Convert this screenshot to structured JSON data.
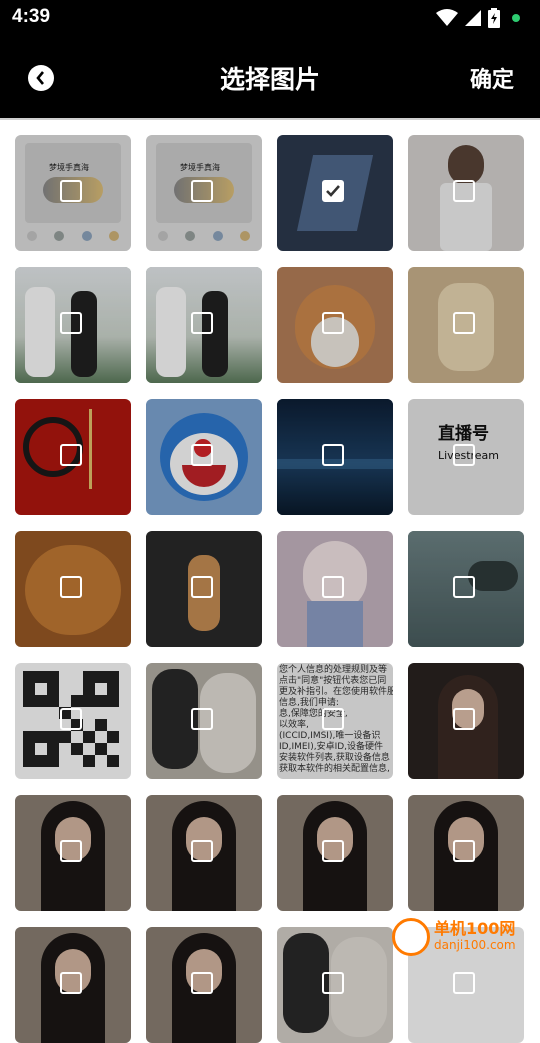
{
  "status": {
    "time": "4:39"
  },
  "header": {
    "title": "选择图片",
    "confirm_label": "确定"
  },
  "thumb_notes": {
    "card_title": "梦境手真海",
    "livestream_title": "直播号",
    "livestream_sub": "Livestream",
    "doc_lines": [
      "您个人信息的处理规则及等",
      "点击\"同意\"按钮代表您已同",
      "更及补指引。在您使用软件服",
      "信息,我们申请:",
      "息,保障您的安全,",
      "以效率,",
      "(ICCID,IMSI),唯一设备识",
      "ID,IMEI),安卓ID,设备硬件",
      "安装软件列表,获取设备信息",
      "获取本软件的相关配置信息,"
    ]
  },
  "thumbs": [
    {
      "name": "palette-card",
      "checked": false,
      "bg": "#e2e2e2"
    },
    {
      "name": "palette-card-2",
      "checked": false,
      "bg": "#e2e2e2"
    },
    {
      "name": "mecha-robot",
      "checked": true,
      "bg": "#2d3a4f"
    },
    {
      "name": "girl-white-dress",
      "checked": false,
      "bg": "#d9d6d4"
    },
    {
      "name": "street-people-1",
      "checked": false,
      "bg": "#6f8a73"
    },
    {
      "name": "street-people-2",
      "checked": false,
      "bg": "#6f8a73"
    },
    {
      "name": "corgi-dog",
      "checked": false,
      "bg": "#b7805a"
    },
    {
      "name": "anime-flowers",
      "checked": false,
      "bg": "#cdb58f"
    },
    {
      "name": "red-poster",
      "checked": false,
      "bg": "#b3160f"
    },
    {
      "name": "doraemon",
      "checked": false,
      "bg": "#7fa8d6"
    },
    {
      "name": "night-lake",
      "checked": false,
      "bg": "#132944"
    },
    {
      "name": "livestream-logo",
      "checked": false,
      "bg": "#e9e9e9"
    },
    {
      "name": "orange-cat",
      "checked": false,
      "bg": "#9a5a25"
    },
    {
      "name": "cat-on-road",
      "checked": false,
      "bg": "#2a2a2a"
    },
    {
      "name": "anime-girl-pink",
      "checked": false,
      "bg": "#c8b7c4"
    },
    {
      "name": "foggy-forest",
      "checked": false,
      "bg": "#52686a"
    },
    {
      "name": "qr-code",
      "checked": false,
      "bg": "#ffffff"
    },
    {
      "name": "sketch-girl",
      "checked": false,
      "bg": "#b6b1a8"
    },
    {
      "name": "privacy-text",
      "checked": false,
      "bg": "#f2f2f2"
    },
    {
      "name": "woman-portrait",
      "checked": false,
      "bg": "#2a2320"
    },
    {
      "name": "girl-long-hair-1",
      "checked": false,
      "bg": "#8d8175"
    },
    {
      "name": "girl-long-hair-2",
      "checked": false,
      "bg": "#8d8175"
    },
    {
      "name": "girl-long-hair-3",
      "checked": false,
      "bg": "#8d8175"
    },
    {
      "name": "girl-long-hair-4",
      "checked": false,
      "bg": "#8d8175"
    },
    {
      "name": "girl-long-hair-5",
      "checked": false,
      "bg": "#8d8175"
    },
    {
      "name": "girl-long-hair-6",
      "checked": false,
      "bg": "#8d8175"
    },
    {
      "name": "sketch-2",
      "checked": false,
      "bg": "#d7d2cb"
    },
    {
      "name": "blank",
      "checked": false,
      "bg": "#ffffff"
    }
  ],
  "watermark": {
    "cn": "单机100网",
    "url": "danji100.com"
  }
}
